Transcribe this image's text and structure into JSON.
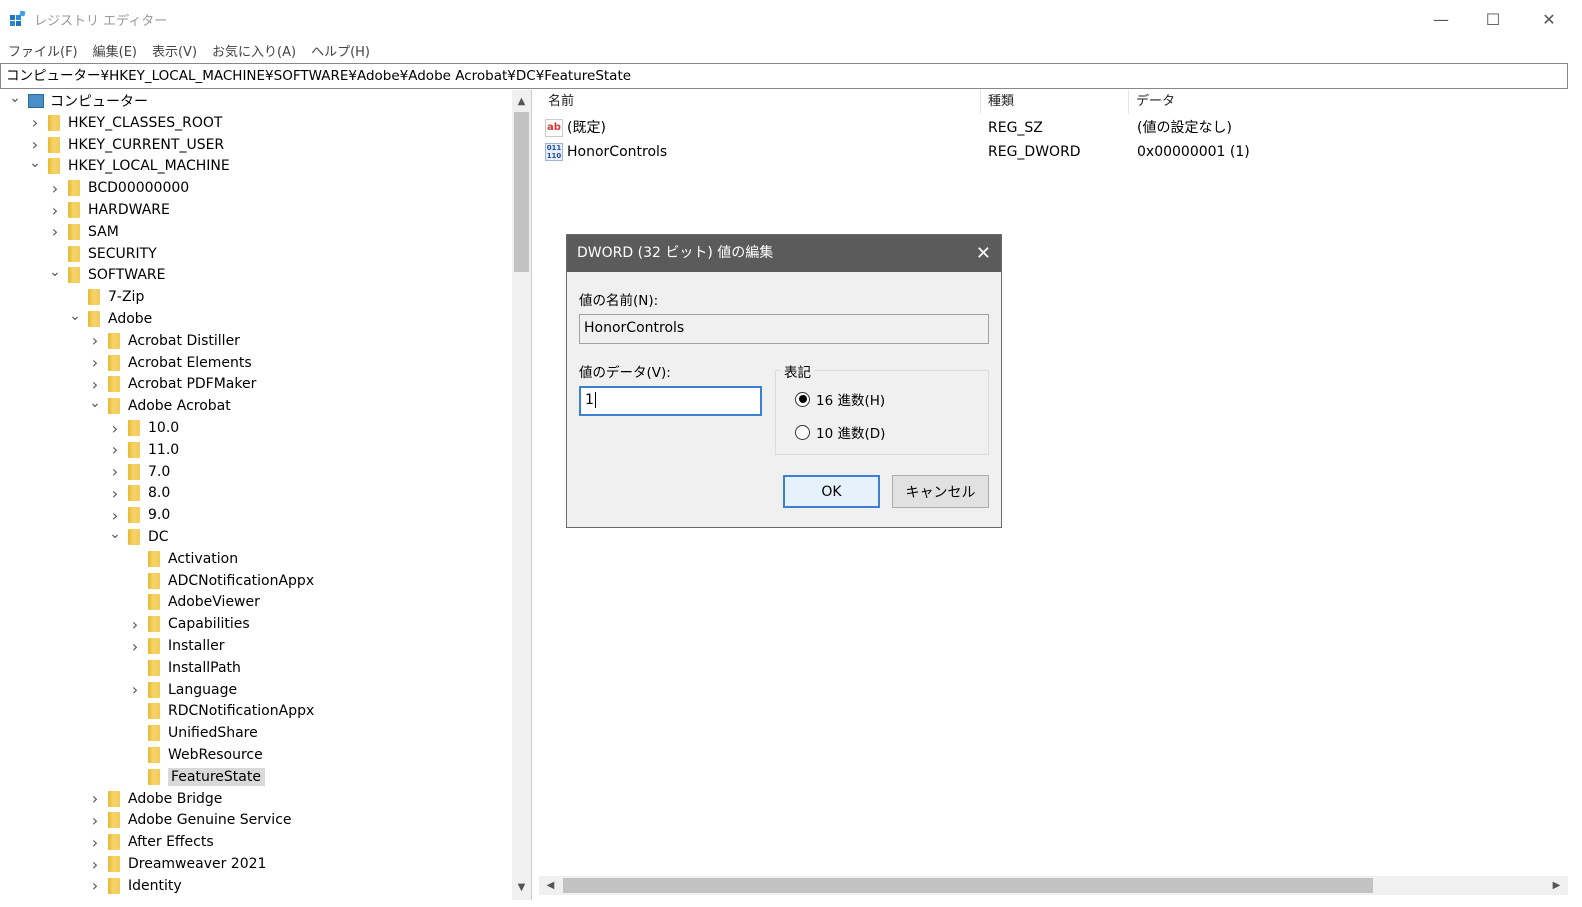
{
  "window": {
    "title": "レジストリ エディター",
    "controls": {
      "minimize": "—",
      "maximize": "☐",
      "close": "✕"
    }
  },
  "menu": [
    "ファイル(F)",
    "編集(E)",
    "表示(V)",
    "お気に入り(A)",
    "ヘルプ(H)"
  ],
  "address": "コンピューター¥HKEY_LOCAL_MACHINE¥SOFTWARE¥Adobe¥Adobe Acrobat¥DC¥FeatureState",
  "tree": [
    {
      "label": "コンピューター",
      "level": 0,
      "expander": "open",
      "icon": "computer-icon"
    },
    {
      "label": "HKEY_CLASSES_ROOT",
      "level": 1,
      "expander": "closed"
    },
    {
      "label": "HKEY_CURRENT_USER",
      "level": 1,
      "expander": "closed"
    },
    {
      "label": "HKEY_LOCAL_MACHINE",
      "level": 1,
      "expander": "open"
    },
    {
      "label": "BCD00000000",
      "level": 2,
      "expander": "closed"
    },
    {
      "label": "HARDWARE",
      "level": 2,
      "expander": "closed"
    },
    {
      "label": "SAM",
      "level": 2,
      "expander": "closed"
    },
    {
      "label": "SECURITY",
      "level": 2,
      "expander": "none"
    },
    {
      "label": "SOFTWARE",
      "level": 2,
      "expander": "open"
    },
    {
      "label": "7-Zip",
      "level": 3,
      "expander": "none"
    },
    {
      "label": "Adobe",
      "level": 3,
      "expander": "open"
    },
    {
      "label": "Acrobat Distiller",
      "level": 4,
      "expander": "closed"
    },
    {
      "label": "Acrobat Elements",
      "level": 4,
      "expander": "closed"
    },
    {
      "label": "Acrobat PDFMaker",
      "level": 4,
      "expander": "closed"
    },
    {
      "label": "Adobe Acrobat",
      "level": 4,
      "expander": "open"
    },
    {
      "label": "10.0",
      "level": 5,
      "expander": "closed"
    },
    {
      "label": "11.0",
      "level": 5,
      "expander": "closed"
    },
    {
      "label": "7.0",
      "level": 5,
      "expander": "closed"
    },
    {
      "label": "8.0",
      "level": 5,
      "expander": "closed"
    },
    {
      "label": "9.0",
      "level": 5,
      "expander": "closed"
    },
    {
      "label": "DC",
      "level": 5,
      "expander": "open"
    },
    {
      "label": "Activation",
      "level": 6,
      "expander": "none"
    },
    {
      "label": "ADCNotificationAppx",
      "level": 6,
      "expander": "none"
    },
    {
      "label": "AdobeViewer",
      "level": 6,
      "expander": "none"
    },
    {
      "label": "Capabilities",
      "level": 6,
      "expander": "closed"
    },
    {
      "label": "Installer",
      "level": 6,
      "expander": "closed"
    },
    {
      "label": "InstallPath",
      "level": 6,
      "expander": "none"
    },
    {
      "label": "Language",
      "level": 6,
      "expander": "closed"
    },
    {
      "label": "RDCNotificationAppx",
      "level": 6,
      "expander": "none"
    },
    {
      "label": "UnifiedShare",
      "level": 6,
      "expander": "none"
    },
    {
      "label": "WebResource",
      "level": 6,
      "expander": "none"
    },
    {
      "label": "FeatureState",
      "level": 6,
      "expander": "none",
      "selected": true
    },
    {
      "label": "Adobe Bridge",
      "level": 4,
      "expander": "closed"
    },
    {
      "label": "Adobe Genuine Service",
      "level": 4,
      "expander": "closed"
    },
    {
      "label": "After Effects",
      "level": 4,
      "expander": "closed"
    },
    {
      "label": "Dreamweaver 2021",
      "level": 4,
      "expander": "closed"
    },
    {
      "label": "Identity",
      "level": 4,
      "expander": "closed"
    }
  ],
  "list": {
    "headers": {
      "name": "名前",
      "type": "種類",
      "data": "データ"
    },
    "rows": [
      {
        "icon": "string-value-icon",
        "icon_text": "ab",
        "name": "(既定)",
        "type": "REG_SZ",
        "data": "(値の設定なし)"
      },
      {
        "icon": "binary-value-icon",
        "icon_text": "011\n110",
        "name": "HonorControls",
        "type": "REG_DWORD",
        "data": "0x00000001 (1)"
      }
    ]
  },
  "dialog": {
    "title": "DWORD (32 ビット) 値の編集",
    "close": "✕",
    "name_label": "値の名前(N):",
    "name_value": "HonorControls",
    "data_label": "値のデータ(V):",
    "data_value": "1",
    "base_label": "表記",
    "hex_option": "16 進数(H)",
    "dec_option": "10 進数(D)",
    "hex_selected": true,
    "ok": "OK",
    "cancel": "キャンセル"
  },
  "colors": {
    "dialog_title_bg": "#5b5b5b",
    "focus_blue": "#3c7fd4",
    "folder_yellow": "#f2ca57"
  }
}
